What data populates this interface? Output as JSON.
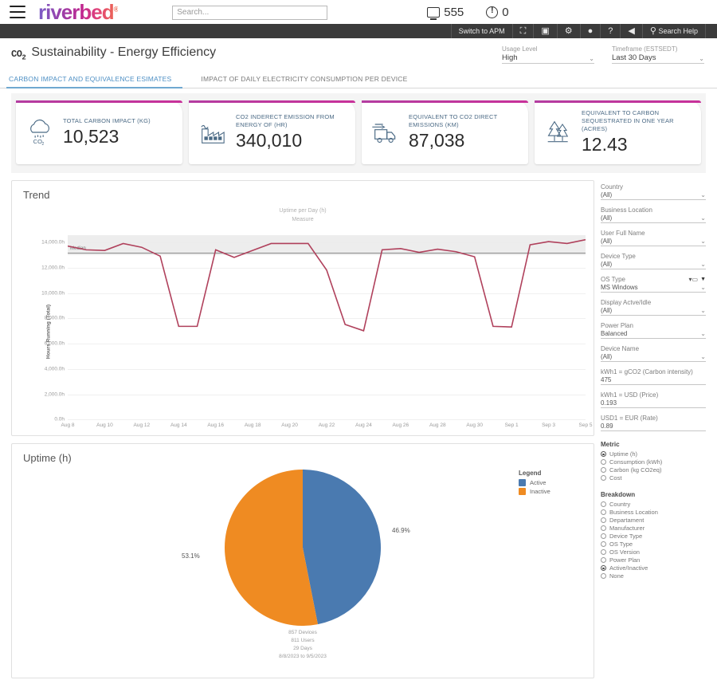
{
  "topbar": {
    "brand": "riverbed",
    "brand_reg": "®",
    "search_placeholder": "Search...",
    "device_count": "555",
    "alert_count": "0"
  },
  "darknav": {
    "switch_label": "Switch to APM",
    "items": [
      {
        "name": "expand-icon",
        "glyph": "⛶"
      },
      {
        "name": "briefcase-icon",
        "glyph": "▣"
      },
      {
        "name": "gear-icon",
        "glyph": "⚙"
      },
      {
        "name": "user-icon",
        "glyph": "●"
      },
      {
        "name": "help-icon",
        "glyph": "?"
      },
      {
        "name": "megaphone-icon",
        "glyph": "◀"
      }
    ],
    "search_help": "Search Help"
  },
  "page": {
    "co2_mark": "CO",
    "co2_sub": "2",
    "title": "Sustainability - Energy Efficiency",
    "usage_level_label": "Usage Level",
    "usage_level_value": "High",
    "timeframe_label": "Timeframe (ESTSEDT)",
    "timeframe_value": "Last 30 Days"
  },
  "tabs": [
    {
      "label": "CARBON IMPACT AND EQUIVALENCE ESIMATES",
      "active": true
    },
    {
      "label": "IMPACT OF DAILY ELECTRICITY CONSUMPTION PER DEVICE",
      "active": false
    }
  ],
  "kpis": [
    {
      "icon": "cloud-co2-icon",
      "label": "TOTAL CARBON IMPACT (KG)",
      "value": "10,523"
    },
    {
      "icon": "factory-icon",
      "label": "CO2 INDERECT EMISSION FROM ENERGY OF (HR)",
      "value": "340,010"
    },
    {
      "icon": "truck-icon",
      "label": "EQUIVALENT TO CO2 DIRECT EMISSIONS (KM)",
      "value": "87,038"
    },
    {
      "icon": "trees-icon",
      "label": "EQUIVALENT TO CARBON SEQUESTRATED IN ONE YEAR (ACRES)",
      "value": "12.43"
    }
  ],
  "trend_panel": {
    "title": "Trend"
  },
  "pie_panel": {
    "title": "Uptime (h)",
    "legend_title": "Legend",
    "footer": "857 Devices\n811 Users\n29 Days\n8/8/2023 to 9/5/2023",
    "footer_lines": [
      "857 Devices",
      "811 Users",
      "29 Days",
      "8/8/2023 to 9/5/2023"
    ]
  },
  "filters": [
    {
      "label": "Country",
      "value": "(All)",
      "has_funnel": false
    },
    {
      "label": "Business Location",
      "value": "(All)",
      "has_funnel": false
    },
    {
      "label": "User Full Name",
      "value": "(All)",
      "has_funnel": false
    },
    {
      "label": "Device Type",
      "value": "(All)",
      "has_funnel": false
    },
    {
      "label": "OS Type",
      "value": "MS Windows",
      "has_funnel": true
    },
    {
      "label": "Display Actve/Idle",
      "value": "(All)",
      "has_funnel": false
    },
    {
      "label": "Power Plan",
      "value": "Balanced",
      "has_funnel": false
    },
    {
      "label": "Device Name",
      "value": "(All)",
      "has_funnel": false
    }
  ],
  "numeric_filters": [
    {
      "label": "kWh1 = gCO2 (Carbon intensity)",
      "value": "475"
    },
    {
      "label": "kWh1 = USD (Price)",
      "value": "0.193"
    },
    {
      "label": "USD1 = EUR (Rate)",
      "value": "0.89"
    }
  ],
  "metric": {
    "title": "Metric",
    "options": [
      {
        "label": "Uptime (h)",
        "selected": true
      },
      {
        "label": "Consumption (kWh)",
        "selected": false
      },
      {
        "label": "Carbon (kg CO2eq)",
        "selected": false
      },
      {
        "label": "Cost",
        "selected": false
      }
    ]
  },
  "breakdown": {
    "title": "Breakdown",
    "options": [
      {
        "label": "Country",
        "selected": false
      },
      {
        "label": "Business Location",
        "selected": false
      },
      {
        "label": "Departament",
        "selected": false
      },
      {
        "label": "Manufacturer",
        "selected": false
      },
      {
        "label": "Device Type",
        "selected": false
      },
      {
        "label": "OS Type",
        "selected": false
      },
      {
        "label": "OS Version",
        "selected": false
      },
      {
        "label": "Power Plan",
        "selected": false
      },
      {
        "label": "Active/Inactive",
        "selected": true
      },
      {
        "label": "None",
        "selected": false
      }
    ]
  },
  "colors": {
    "line": "#b0415c",
    "active": "#4a7ab0",
    "inactive": "#ef8b22",
    "kpi_accent": "#c0268f",
    "tab_active": "#4d8fc4"
  },
  "chart_data": [
    {
      "type": "line",
      "title": "Trend",
      "subtitle": "Uptime per Day (h)\nMeasure",
      "subtitle_lines": [
        "Uptime per Day (h)",
        "Measure"
      ],
      "xlabel": "",
      "ylabel": "Hours Running (Total)",
      "ylim": [
        0,
        15000
      ],
      "yticks": [
        "0.0h",
        "2,000.0h",
        "4,000.0h",
        "6,000.0h",
        "8,000.0h",
        "10,000.0h",
        "12,000.0h",
        "14,000.0h"
      ],
      "ytick_values": [
        0,
        2000,
        4000,
        6000,
        8000,
        10000,
        12000,
        14000
      ],
      "xticks": [
        "Aug 8",
        "Aug 10",
        "Aug 12",
        "Aug 14",
        "Aug 16",
        "Aug 18",
        "Aug 20",
        "Aug 22",
        "Aug 24",
        "Aug 26",
        "Aug 28",
        "Aug 30",
        "Sep 1",
        "Sep 3",
        "Sep 5"
      ],
      "median_label": "Median",
      "median_value": 13200,
      "band": [
        13000,
        14600
      ],
      "grid": true,
      "legend": "none",
      "series": [
        {
          "name": "Uptime per Day (h)",
          "color": "#b0415c",
          "x": [
            "Aug 8",
            "Aug 9",
            "Aug 10",
            "Aug 11",
            "Aug 12",
            "Aug 13",
            "Aug 14",
            "Aug 15",
            "Aug 16",
            "Aug 17",
            "Aug 18",
            "Aug 19",
            "Aug 20",
            "Aug 21",
            "Aug 22",
            "Aug 23",
            "Aug 24",
            "Aug 25",
            "Aug 26",
            "Aug 27",
            "Aug 28",
            "Aug 29",
            "Aug 30",
            "Aug 31",
            "Sep 1",
            "Sep 2",
            "Sep 3",
            "Sep 4",
            "Sep 5"
          ],
          "values": [
            13700,
            13400,
            13350,
            13900,
            13600,
            12900,
            7350,
            7350,
            13400,
            12800,
            13350,
            13900,
            13900,
            13900,
            11800,
            7500,
            7000,
            13400,
            13500,
            13200,
            13450,
            13250,
            12850,
            7350,
            7300,
            13800,
            14050,
            13900,
            14200
          ]
        }
      ]
    },
    {
      "type": "pie",
      "title": "Uptime (h)",
      "labels": [
        "Active",
        "Inactive"
      ],
      "values": [
        46.9,
        53.1
      ],
      "value_labels": [
        "46.9%",
        "53.1%"
      ],
      "colors": [
        "#4a7ab0",
        "#ef8b22"
      ],
      "legend": "right"
    }
  ]
}
